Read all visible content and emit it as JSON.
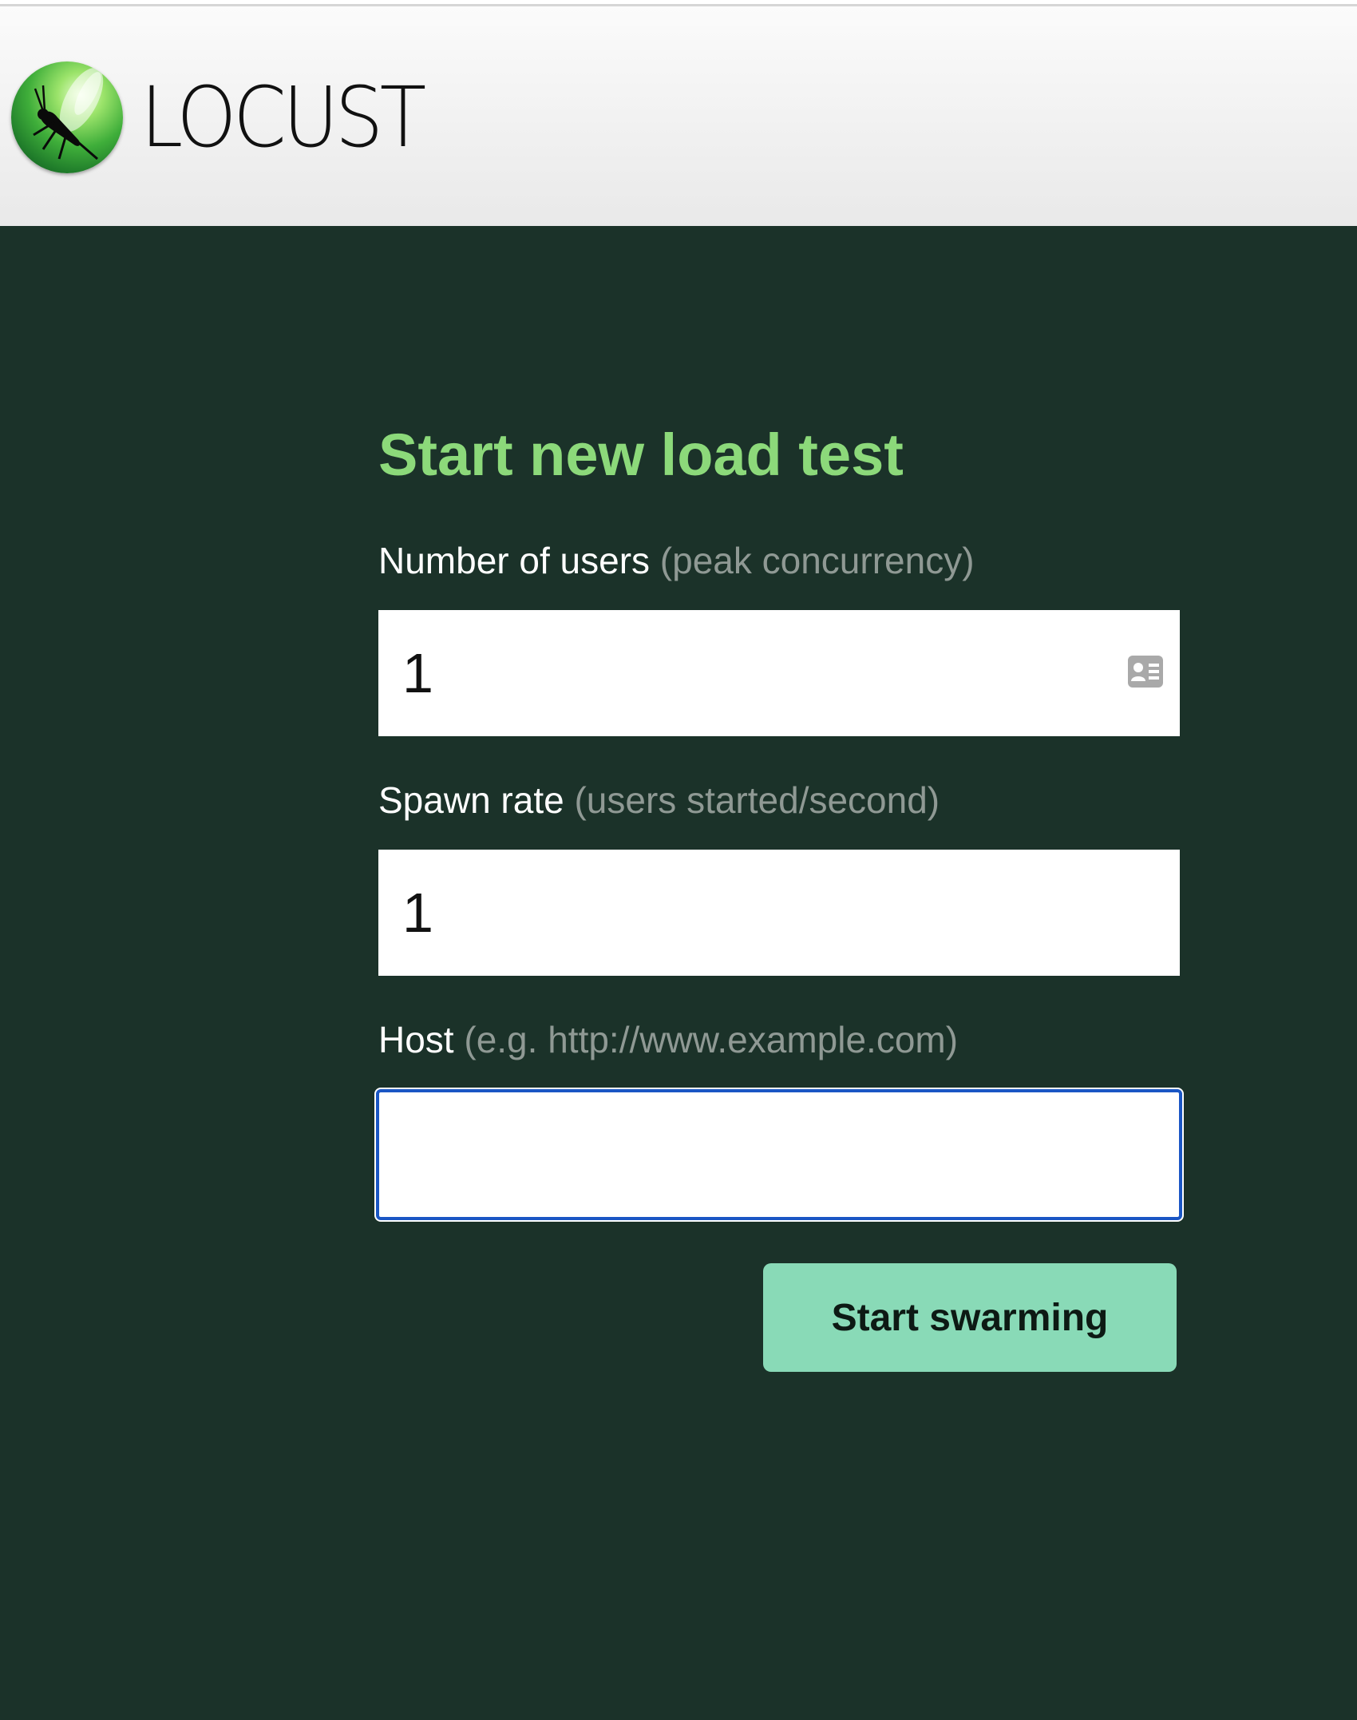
{
  "brand": {
    "name": "LOCUST",
    "logo_icon": "locust-logo-icon"
  },
  "form": {
    "title": "Start new load test",
    "users": {
      "label": "Number of users",
      "hint": "(peak concurrency)",
      "value": "1",
      "icon": "contact-card-icon"
    },
    "spawn_rate": {
      "label": "Spawn rate",
      "hint": "(users started/second)",
      "value": "1"
    },
    "host": {
      "label": "Host",
      "hint": "(e.g. http://www.example.com)",
      "value": "",
      "focused": true
    },
    "submit_label": "Start swarming"
  },
  "colors": {
    "background": "#1b3229",
    "title": "#8cd97a",
    "button": "#89dab7",
    "focus_ring": "#1a56c4",
    "hint": "#8f9994"
  }
}
